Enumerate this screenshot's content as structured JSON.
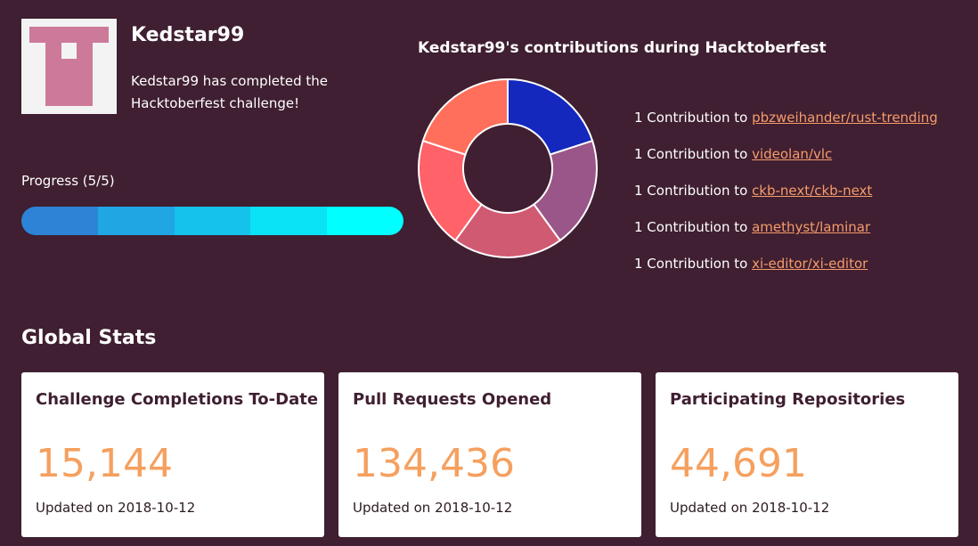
{
  "profile": {
    "username": "Kedstar99",
    "completed_text": "Kedstar99 has completed the Hacktoberfest challenge!",
    "avatar_icon": "identicon-avatar",
    "avatar_color": "#cd7a9a"
  },
  "progress": {
    "label": "Progress (5/5)",
    "completed": 5,
    "total": 5,
    "fraction": 1.0,
    "segment_colors": [
      "#2d84d6",
      "#1fa6e3",
      "#14c2ec",
      "#0ae2f6",
      "#00ffff"
    ]
  },
  "chart_data": {
    "type": "pie",
    "title": "Kedstar99's contributions during Hacktoberfest",
    "categories": [
      "pbzweihander/rust-trending",
      "videolan/vlc",
      "ckb-next/ckb-next",
      "amethyst/laminar",
      "xi-editor/xi-editor"
    ],
    "values": [
      1,
      1,
      1,
      1,
      1
    ],
    "colors": [
      "#1428be",
      "#9a5688",
      "#d05a72",
      "#ff6268",
      "#ff6f5c"
    ],
    "donut": true,
    "legend": "right"
  },
  "contributions": [
    {
      "prefix": "1 Contribution to",
      "repo": "pbzweihander/rust-trending"
    },
    {
      "prefix": "1 Contribution to",
      "repo": "videolan/vlc"
    },
    {
      "prefix": "1 Contribution to",
      "repo": "ckb-next/ckb-next"
    },
    {
      "prefix": "1 Contribution to",
      "repo": "amethyst/laminar"
    },
    {
      "prefix": "1 Contribution to",
      "repo": "xi-editor/xi-editor"
    }
  ],
  "global": {
    "title": "Global Stats",
    "cards": [
      {
        "title": "Challenge Completions To-Date",
        "value": "15,144",
        "updated": "Updated on 2018-10-12"
      },
      {
        "title": "Pull Requests Opened",
        "value": "134,436",
        "updated": "Updated on 2018-10-12"
      },
      {
        "title": "Participating Repositories",
        "value": "44,691",
        "updated": "Updated on 2018-10-12"
      }
    ]
  },
  "colors": {
    "background": "#3f1f31",
    "link": "#f69b6a",
    "stat_value": "#f5a05f",
    "card_title": "#3f1f31"
  }
}
